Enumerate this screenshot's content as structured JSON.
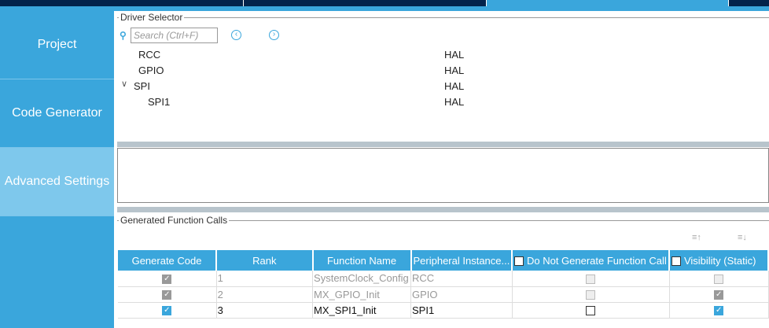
{
  "sidebar": {
    "items": [
      {
        "label": "Project"
      },
      {
        "label": "Code Generator"
      },
      {
        "label": "Advanced Settings",
        "active": true
      }
    ]
  },
  "driver_selector": {
    "title": "Driver Selector",
    "search_placeholder": "Search (Ctrl+F)",
    "rows": [
      {
        "name": "RCC",
        "driver": "HAL"
      },
      {
        "name": "GPIO",
        "driver": "HAL"
      },
      {
        "name": "SPI",
        "driver": "HAL"
      },
      {
        "name": "SPI1",
        "driver": "HAL"
      }
    ]
  },
  "function_calls": {
    "title": "Generated Function Calls",
    "headers": [
      "Generate Code",
      "Rank",
      "Function Name",
      "Peripheral Instance...",
      "Do Not Generate Function Call",
      "Visibility (Static)"
    ],
    "rows": [
      {
        "rank": "1",
        "function": "SystemClock_Config",
        "instance": "RCC"
      },
      {
        "rank": "2",
        "function": "MX_GPIO_Init",
        "instance": "GPIO"
      },
      {
        "rank": "3",
        "function": "MX_SPI1_Init",
        "instance": "SPI1"
      }
    ]
  },
  "colors": {
    "accent": "#3aa6dc",
    "topbar": "#03234b"
  }
}
